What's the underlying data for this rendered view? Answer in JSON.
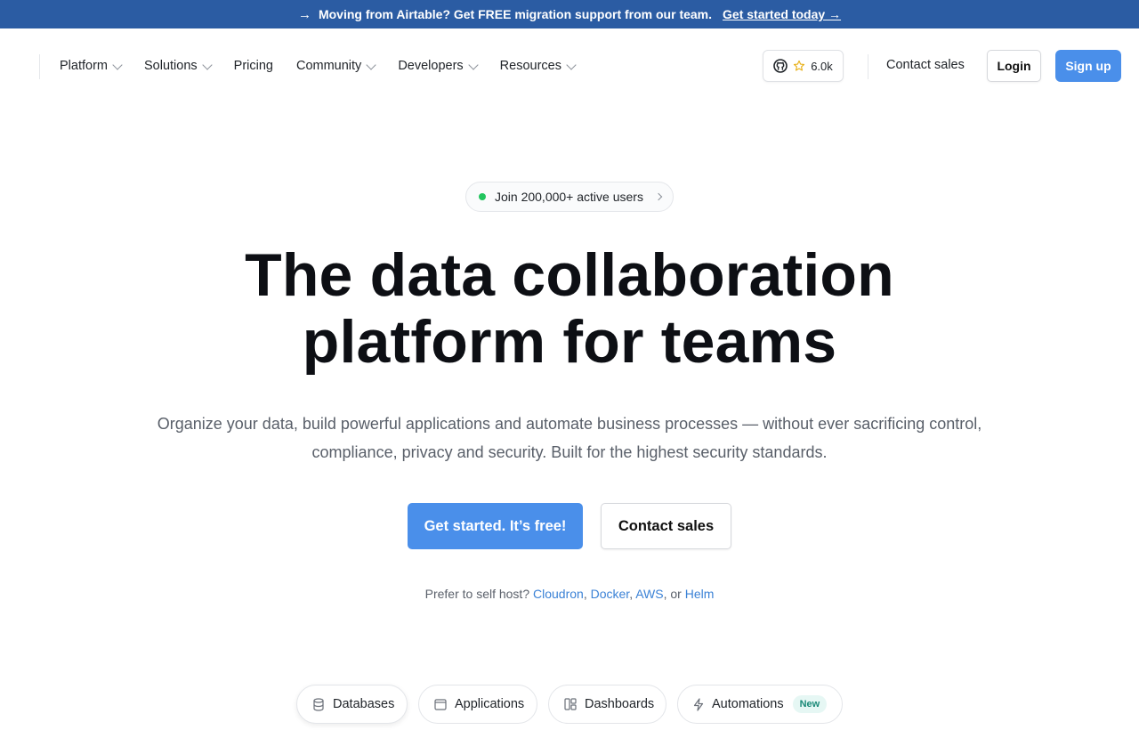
{
  "announcement": {
    "arrow": "→",
    "text": "Moving from Airtable? Get FREE migration support from our team.",
    "link": "Get started today →"
  },
  "nav": {
    "items": [
      {
        "label": "Platform",
        "dropdown": true
      },
      {
        "label": "Solutions",
        "dropdown": true
      },
      {
        "label": "Pricing",
        "dropdown": false
      },
      {
        "label": "Community",
        "dropdown": true
      },
      {
        "label": "Developers",
        "dropdown": true
      },
      {
        "label": "Resources",
        "dropdown": true
      }
    ],
    "github_stars": "6.0k",
    "contact_sales": "Contact sales",
    "login": "Login",
    "signup": "Sign up"
  },
  "hero": {
    "pill": "Join 200,000+ active users",
    "title_line1": "The data collaboration",
    "title_line2": "platform for teams",
    "subtitle_line1": "Organize your data, build powerful applications and automate business processes — without ever sacrificing control,",
    "subtitle_line2": "compliance, privacy and security. Built for the highest security standards.",
    "cta_primary": "Get started. It’s free!",
    "cta_secondary": "Contact sales",
    "selfhost_prefix": "Prefer to self host?",
    "selfhost_links": [
      "Cloudron",
      "Docker",
      "AWS",
      "Helm"
    ],
    "selfhost_sep": ",",
    "selfhost_or": "or"
  },
  "tabs": [
    {
      "label": "Databases",
      "icon": "database-icon"
    },
    {
      "label": "Applications",
      "icon": "window-icon"
    },
    {
      "label": "Dashboards",
      "icon": "dashboard-icon"
    },
    {
      "label": "Automations",
      "icon": "bolt-icon",
      "badge": "New"
    }
  ],
  "colors": {
    "announcement_bg": "#2b5ca3",
    "primary": "#4a8fea",
    "status_green": "#22c55e",
    "link": "#3b82d6"
  }
}
